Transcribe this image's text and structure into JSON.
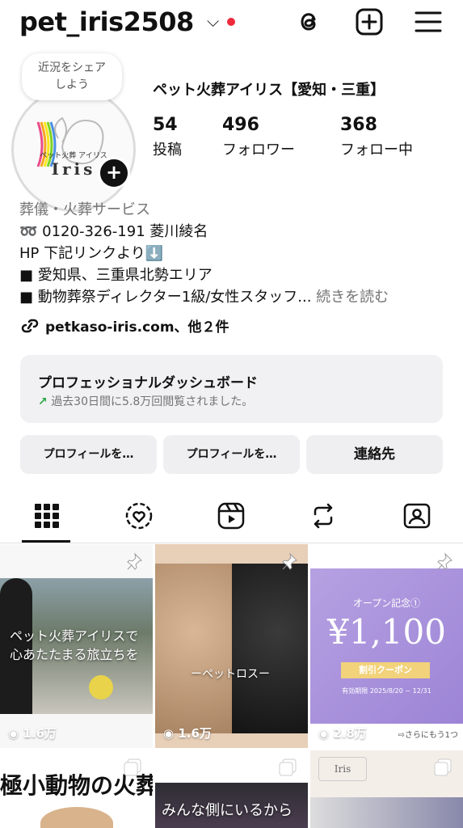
{
  "header": {
    "username": "pet_iris2508",
    "dropdown_icon": "chevron-down-icon",
    "notification_dot_color": "#ee2a3c",
    "actions": [
      "threads-icon",
      "plus-square-icon",
      "menu-icon"
    ]
  },
  "profile": {
    "note": "近況をシェア\nしよう",
    "note_line1": "近況をシェア",
    "note_line2": "しよう",
    "avatar_brand": "ペット火葬 アイリス",
    "avatar_logo": "Iris",
    "display_name": "ペット火葬アイリス【愛知・三重】",
    "stats": [
      {
        "value": "54",
        "label": "投稿"
      },
      {
        "value": "496",
        "label": "フォロワー"
      },
      {
        "value": "368",
        "label": "フォロー中"
      }
    ],
    "category": "葬儀・火葬サービス",
    "bio": [
      "➿ 0120-326-191 菱川綾名",
      "HP 下記リンクより⬇️",
      "■ 愛知県、三重県北勢エリア",
      "■ 動物葬祭ディレクター1級/女性スタッフ..."
    ],
    "read_more": "続きを読む",
    "link": "petkaso-iris.com、他２件"
  },
  "dashboard": {
    "title": "プロフェッショナルダッシュボード",
    "subtitle": "過去30日間に5.8万回閲覧されました。",
    "trend_icon": "↗",
    "accent": "#28a745"
  },
  "buttons": {
    "edit_profile": "プロフィールを…",
    "share_profile": "プロフィールを…",
    "contact": "連絡先"
  },
  "tabs": [
    "grid-icon",
    "reels-heart-icon",
    "reels-icon",
    "reposts-icon",
    "tagged-icon"
  ],
  "posts": [
    {
      "caption_line1": "ペット火葬アイリスで",
      "caption_line2": "心あたたまる旅立ちを",
      "views": "1.6万"
    },
    {
      "caption": "ーペットロスー",
      "views": "1.6万"
    },
    {
      "heading": "オープン記念①",
      "price": "¥1,100",
      "badge": "割引クーポン",
      "period": "有効期限 2025/8/20 ~ 12/31",
      "views": "2.8万",
      "more": "⇨さらにもう1つ"
    },
    {
      "caption": "極小動物の火葬"
    },
    {
      "caption": "みんな側にいるから"
    },
    {
      "logo": "Iris"
    }
  ]
}
